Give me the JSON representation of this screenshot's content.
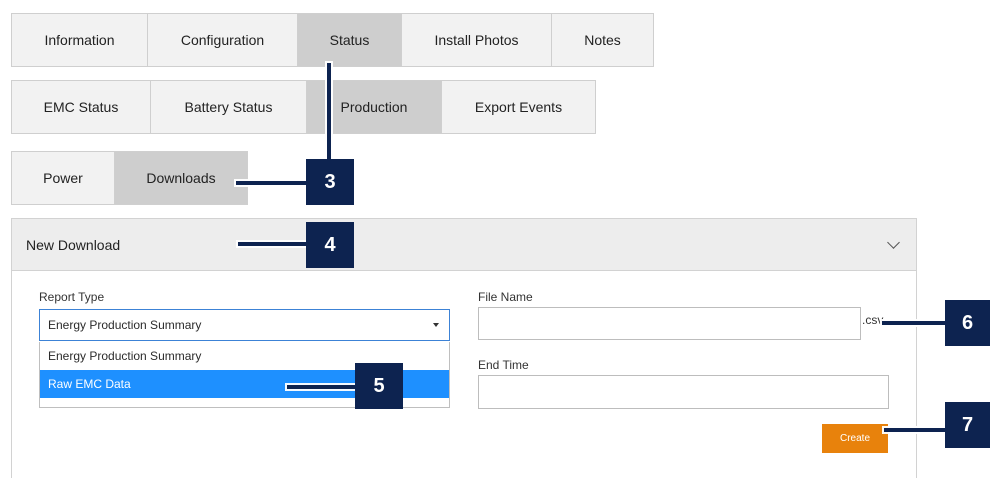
{
  "tabs_main": [
    {
      "label": "Information",
      "active": false
    },
    {
      "label": "Configuration",
      "active": false
    },
    {
      "label": "Status",
      "active": true
    },
    {
      "label": "Install Photos",
      "active": false
    },
    {
      "label": "Notes",
      "active": false
    }
  ],
  "tabs_status": [
    {
      "label": "EMC Status",
      "active": false
    },
    {
      "label": "Battery Status",
      "active": false
    },
    {
      "label": "Production",
      "active": true
    },
    {
      "label": "Export Events",
      "active": false
    }
  ],
  "tabs_production": [
    {
      "label": "Power",
      "active": false
    },
    {
      "label": "Downloads",
      "active": true
    }
  ],
  "panel": {
    "title": "New Download",
    "report_type": {
      "label": "Report Type",
      "value": "Energy Production Summary",
      "options": [
        "Energy Production Summary",
        "Raw EMC Data"
      ],
      "highlighted": "Raw EMC Data"
    },
    "file_name": {
      "label": "File Name",
      "value": "",
      "suffix": ".csv"
    },
    "end_time": {
      "label": "End Time",
      "value": ""
    },
    "create_label": "Create"
  },
  "callouts": [
    "3",
    "4",
    "5",
    "6",
    "7"
  ],
  "colors": {
    "navy": "#0d2350",
    "orange": "#e8820c",
    "blue": "#1e90ff",
    "active_tab": "#cecece"
  }
}
